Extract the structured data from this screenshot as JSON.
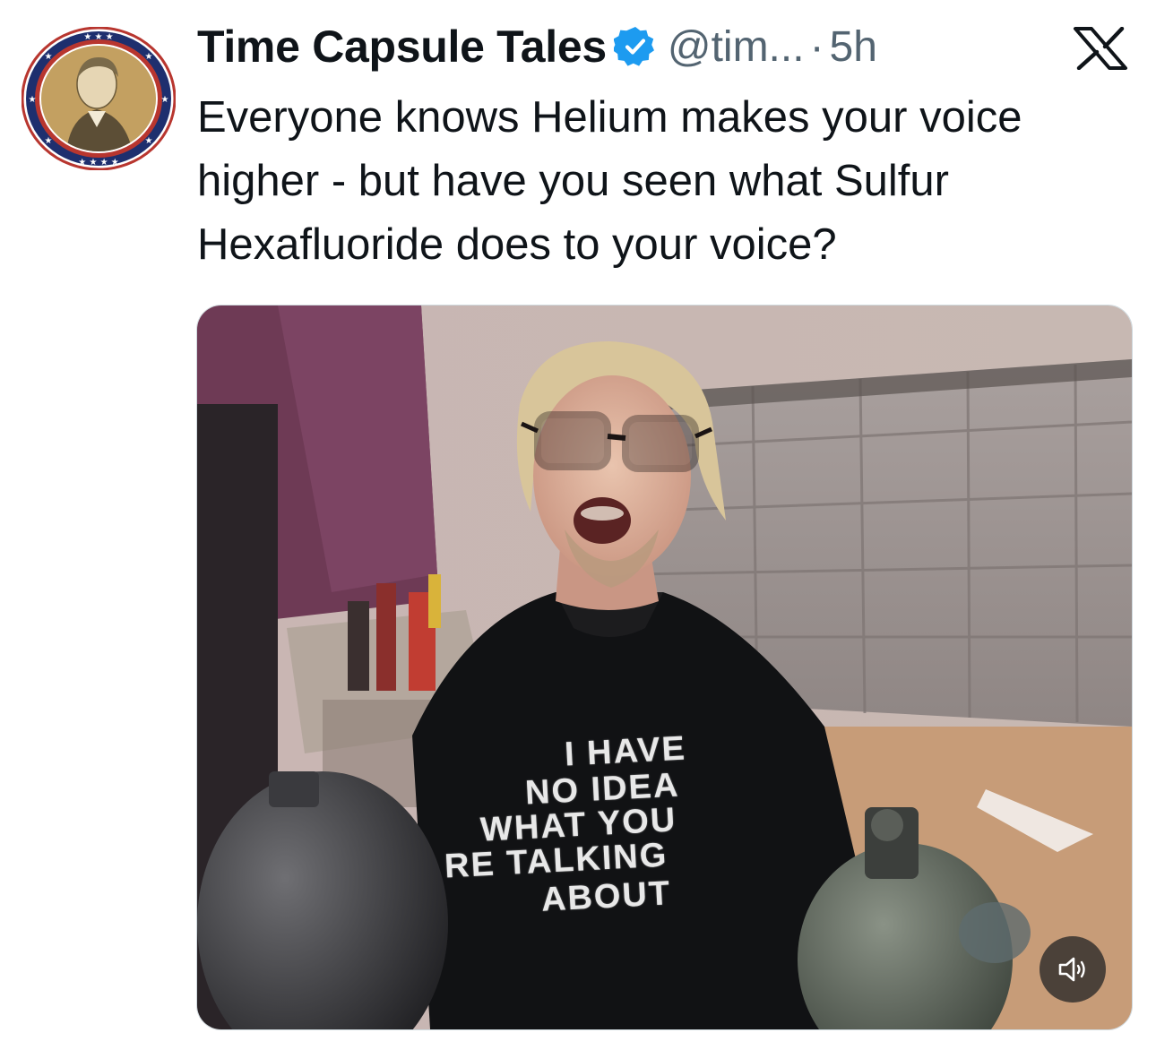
{
  "tweet": {
    "display_name": "Time Capsule Tales",
    "handle": "@tim...",
    "separator": "·",
    "time": "5h",
    "text": "Everyone knows Helium makes your voice higher - but have you seen what Sulfur Hexafluoride does to your voice?"
  },
  "media": {
    "shirt_lines": [
      "I HAVE",
      "NO IDEA",
      "WHAT YOU",
      "RE TALKING",
      "ABOUT"
    ],
    "sound_icon": "speaker-muted-icon"
  },
  "icons": {
    "verified": "verified-badge-icon",
    "platform": "x-logo-icon"
  },
  "colors": {
    "verified_blue": "#1d9bf0",
    "secondary_text": "#536471",
    "primary_text": "#0f1419"
  }
}
